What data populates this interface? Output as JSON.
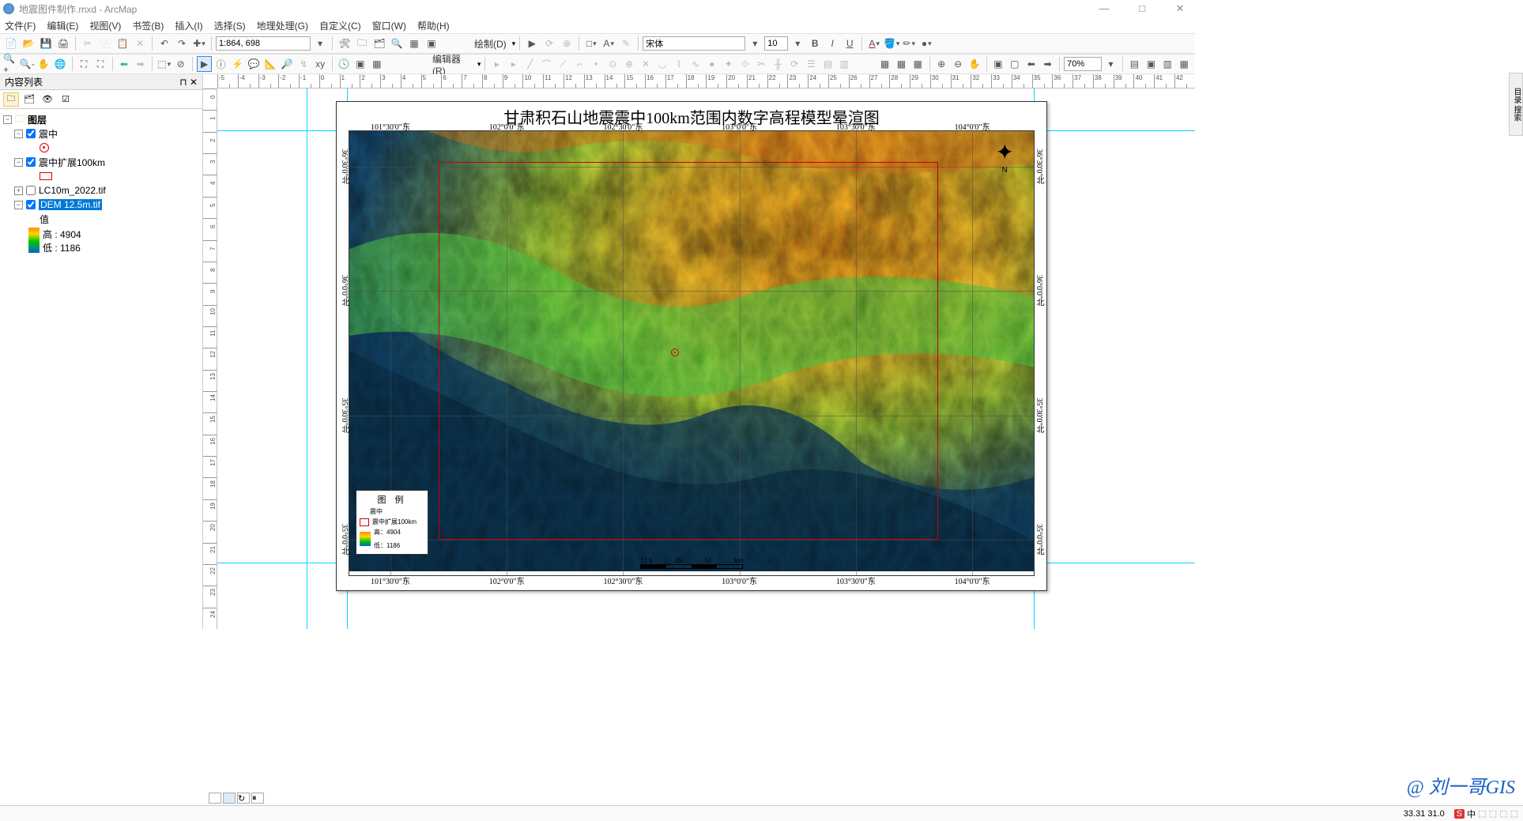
{
  "title": "地震图件制作.mxd - ArcMap",
  "menu": [
    "文件(F)",
    "编辑(E)",
    "视图(V)",
    "书签(B)",
    "插入(I)",
    "选择(S)",
    "地理处理(G)",
    "自定义(C)",
    "窗口(W)",
    "帮助(H)"
  ],
  "scale": "1:864, 698",
  "draw_label": "绘制(D)",
  "font_name": "宋体",
  "font_size": "10",
  "editor_label": "编辑器(R)",
  "zoom_pct": "70%",
  "toc": {
    "title": "内容列表",
    "layers_label": "图层",
    "l1": "震中",
    "l2": "震中扩展100km",
    "l3": "LC10m_2022.tif",
    "l4": "DEM 12.5m.tif",
    "val_label": "值",
    "high": "高 : 4904",
    "low": "低 : 1186"
  },
  "map": {
    "title": "甘肃积石山地震震中100km范围内数字高程模型晕渲图",
    "lon_ticks": [
      "101°30'0\"东",
      "102°0'0\"东",
      "102°30'0\"东",
      "103°0'0\"东",
      "103°30'0\"东",
      "104°0'0\"东"
    ],
    "lat_ticks": [
      "36°30'0\"北",
      "36°0'0\"北",
      "35°30'0\"北",
      "35°0'0\"北"
    ],
    "legend_title": "图 例",
    "leg1": "震中",
    "leg2": "震中扩展100km",
    "leg_high": "高：4904",
    "leg_low": "低：1186",
    "scale_labels": [
      "12.5",
      "25",
      "50"
    ],
    "scale_unit": "km"
  },
  "status_coord": "33.31  31.0",
  "watermark": "@ 刘一哥GIS",
  "dock_right": "目录 搜索"
}
